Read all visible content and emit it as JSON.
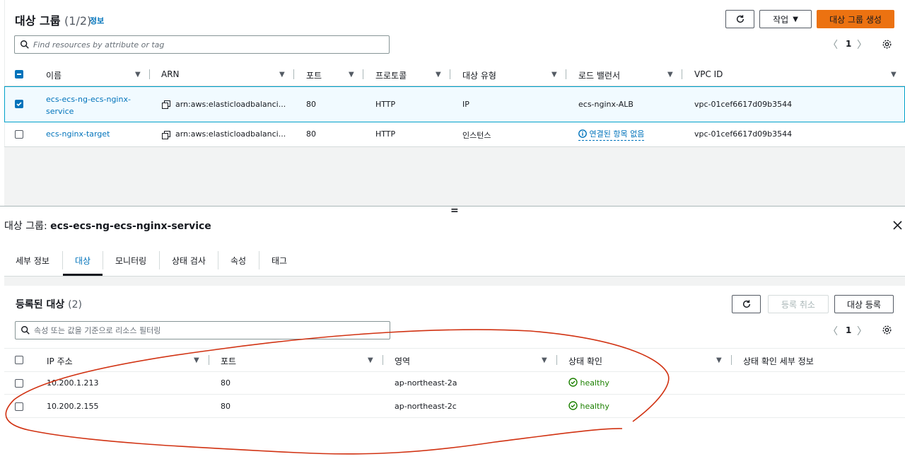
{
  "top": {
    "title": "대상 그룹",
    "count": "(1/2)",
    "info": "정보",
    "actions_label": "작업",
    "create_label": "대상 그룹 생성",
    "search_placeholder": "Find resources by attribute or tag",
    "page": "1",
    "columns": [
      "이름",
      "ARN",
      "포트",
      "프로토콜",
      "대상 유형",
      "로드 밸런서",
      "VPC ID"
    ],
    "rows": [
      {
        "checked": true,
        "name": "ecs-ecs-ng-ecs-nginx-service",
        "name_l1": "ecs-ecs-ng-ecs-nginx-",
        "name_l2": "service",
        "arn": "arn:aws:elasticloadbalanci...",
        "port": "80",
        "protocol": "HTTP",
        "target_type": "IP",
        "lb": "ecs-nginx-ALB",
        "vpc": "vpc-01cef6617d09b3544"
      },
      {
        "checked": false,
        "name": "ecs-nginx-target",
        "arn": "arn:aws:elasticloadbalanci...",
        "port": "80",
        "protocol": "HTTP",
        "target_type": "인스턴스",
        "lb": "연결된 항목 없음",
        "vpc": "vpc-01cef6617d09b3544"
      }
    ]
  },
  "detail": {
    "title_prefix": "대상 그룹:",
    "title_name": "ecs-ecs-ng-ecs-nginx-service",
    "splitter": "=",
    "tabs": [
      "세부 정보",
      "대상",
      "모니터링",
      "상태 검사",
      "속성",
      "태그"
    ],
    "active_tab": 1,
    "registered_title": "등록된 대상",
    "registered_count": "(2)",
    "deregister_label": "등록 취소",
    "register_label": "대상 등록",
    "search_placeholder": "속성 또는 값을 기준으로 리소스 필터링",
    "page": "1",
    "columns": [
      "IP 주소",
      "포트",
      "영역",
      "상태 확인",
      "상태 확인 세부 정보"
    ],
    "rows": [
      {
        "ip": "10.200.1.213",
        "port": "80",
        "zone": "ap-northeast-2a",
        "health": "healthy"
      },
      {
        "ip": "10.200.2.155",
        "port": "80",
        "zone": "ap-northeast-2c",
        "health": "healthy"
      }
    ]
  },
  "colors": {
    "accent": "#0073bb",
    "primary": "#ec7211",
    "healthy": "#1d8102",
    "annotation": "#d13212"
  },
  "icons": [
    "refresh-icon",
    "caret-down-icon",
    "search-icon",
    "settings-icon",
    "copy-icon",
    "info-icon",
    "status-ok-icon",
    "close-icon",
    "chevron-left-icon",
    "chevron-right-icon"
  ]
}
